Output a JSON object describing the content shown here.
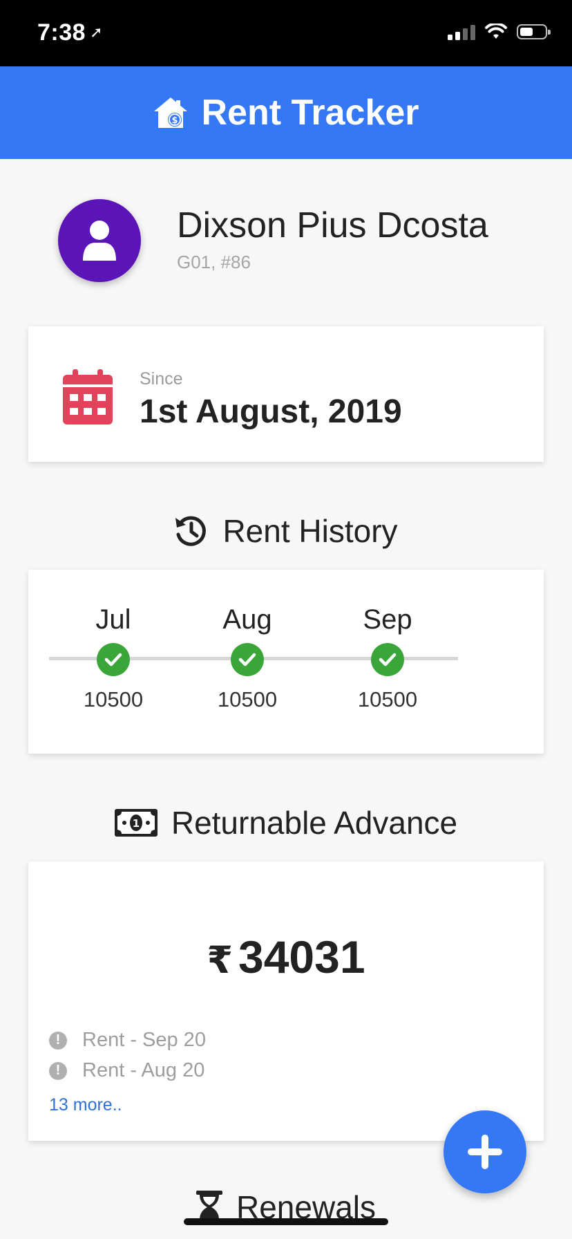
{
  "status_bar": {
    "time": "7:38"
  },
  "header": {
    "title": "Rent Tracker",
    "icon": "house-money-icon"
  },
  "profile": {
    "name": "Dixson Pius Dcosta",
    "unit": "G01, #86",
    "icon": "user-icon",
    "avatar_color": "#5a14b8"
  },
  "since": {
    "label": "Since",
    "date": "1st August, 2019",
    "icon": "calendar-icon",
    "icon_color": "#e0435a"
  },
  "rent_history": {
    "title": "Rent History",
    "icon": "history-icon",
    "months": [
      {
        "month": "Jul",
        "amount": "10500",
        "status": "paid"
      },
      {
        "month": "Aug",
        "amount": "10500",
        "status": "paid"
      },
      {
        "month": "Sep",
        "amount": "10500",
        "status": "paid"
      }
    ]
  },
  "advance": {
    "title": "Returnable Advance",
    "icon": "money-bill-icon",
    "currency": "₹",
    "amount": "34031",
    "items": [
      "Rent - Sep 20",
      "Rent - Aug 20"
    ],
    "more": "13 more.."
  },
  "renewals": {
    "title": "Renewals",
    "icon": "hourglass-icon"
  },
  "fab": {
    "icon": "plus-icon"
  },
  "colors": {
    "primary": "#3478f6",
    "success": "#3aa63a",
    "link": "#2f6fd6"
  }
}
